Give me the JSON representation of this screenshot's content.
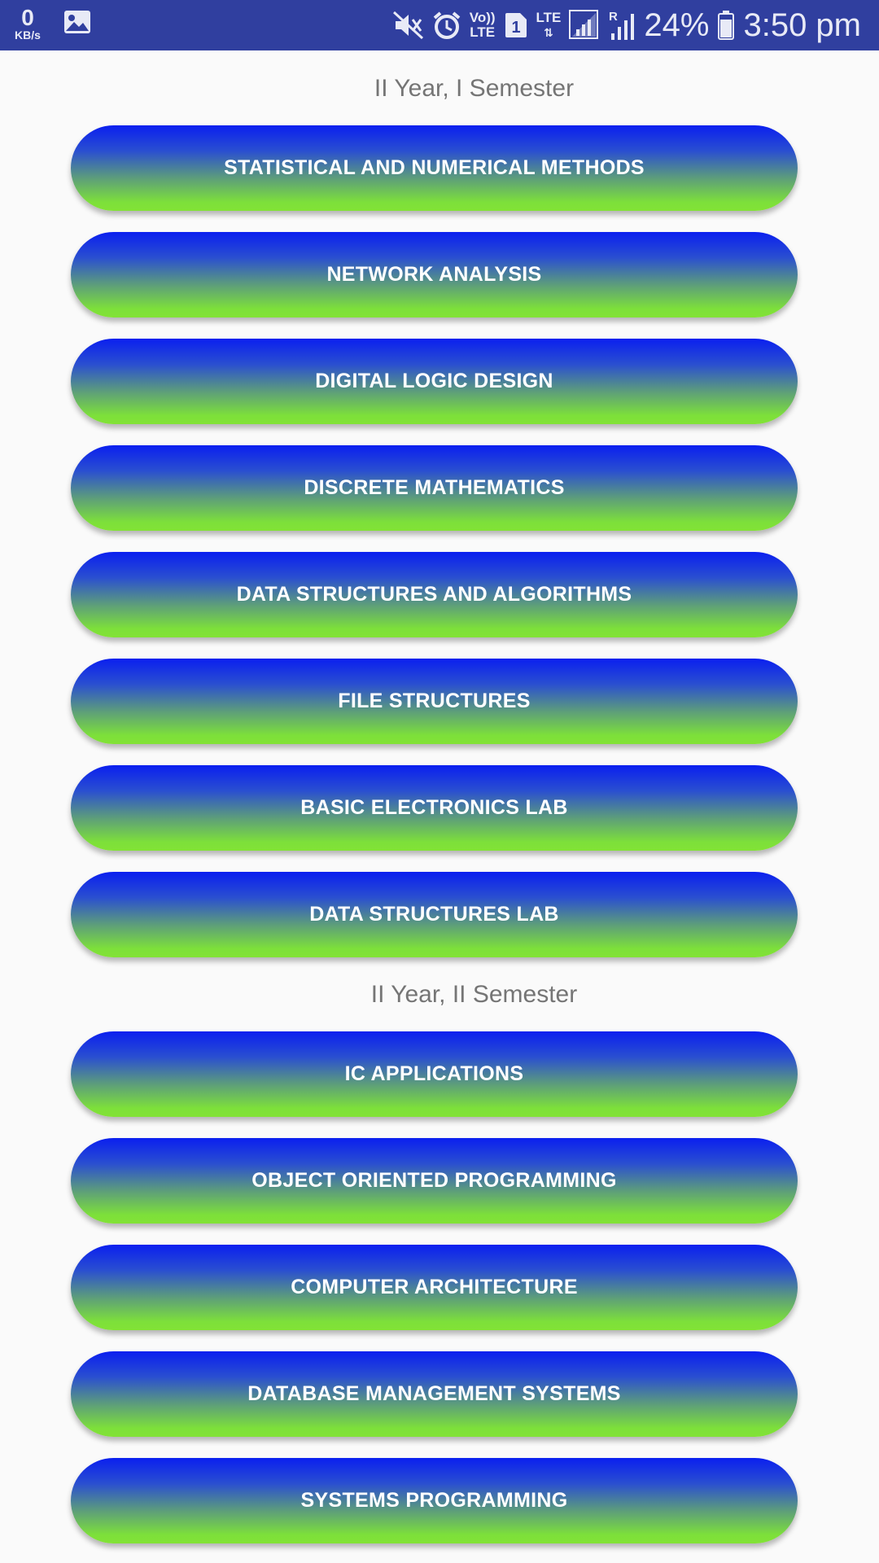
{
  "status_bar": {
    "net_speed_value": "0",
    "net_speed_unit": "KB/s",
    "volte_top": "Vo))",
    "volte_bottom": "LTE",
    "sim_number": "1",
    "lte_label": "LTE",
    "roaming_label": "R",
    "battery_percent": "24%",
    "time": "3:50 pm",
    "icons": [
      "gallery-icon",
      "mute-icon",
      "alarm-icon",
      "volte-icon",
      "sim-icon",
      "signal-icon",
      "battery-icon"
    ]
  },
  "sections": [
    {
      "title": "II Year, I Semester",
      "courses": [
        "STATISTICAL AND NUMERICAL METHODS",
        "NETWORK ANALYSIS",
        "DIGITAL LOGIC DESIGN",
        "DISCRETE MATHEMATICS",
        "DATA STRUCTURES AND ALGORITHMS",
        "FILE STRUCTURES",
        "BASIC ELECTRONICS LAB",
        "DATA STRUCTURES LAB"
      ]
    },
    {
      "title": "II Year, II Semester",
      "courses": [
        "IC APPLICATIONS",
        "OBJECT ORIENTED PROGRAMMING",
        "COMPUTER ARCHITECTURE",
        "DATABASE MANAGEMENT SYSTEMS",
        "SYSTEMS PROGRAMMING"
      ]
    }
  ],
  "colors": {
    "status_bar_bg": "#303f9f",
    "gradient_top": "#0a1ff0",
    "gradient_bottom": "#82e236",
    "section_title": "#757575"
  }
}
